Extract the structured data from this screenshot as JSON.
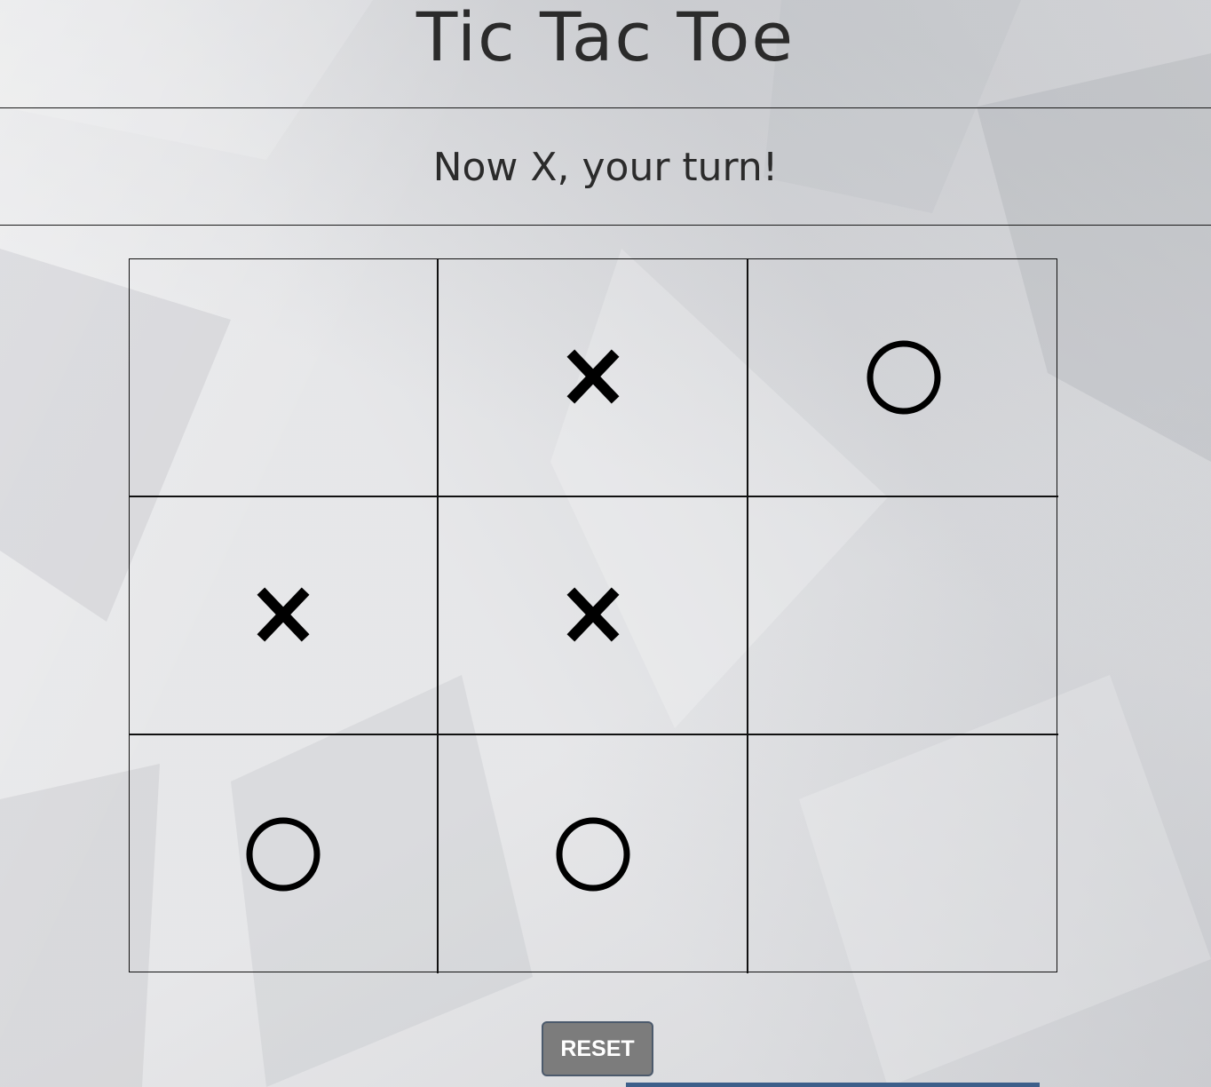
{
  "header": {
    "title": "Tic Tac Toe"
  },
  "status": {
    "message": "Now X, your turn!"
  },
  "board": {
    "cells": [
      [
        "",
        "X",
        "O"
      ],
      [
        "X",
        "X",
        ""
      ],
      [
        "O",
        "O",
        ""
      ]
    ]
  },
  "controls": {
    "reset_label": "RESET"
  },
  "colors": {
    "background": "#dcdde0",
    "grid_lines": "#111111",
    "marks": "#000000",
    "button_bg": "#7c7c7c",
    "button_border": "#4c5a6c",
    "button_text": "#ffffff"
  }
}
